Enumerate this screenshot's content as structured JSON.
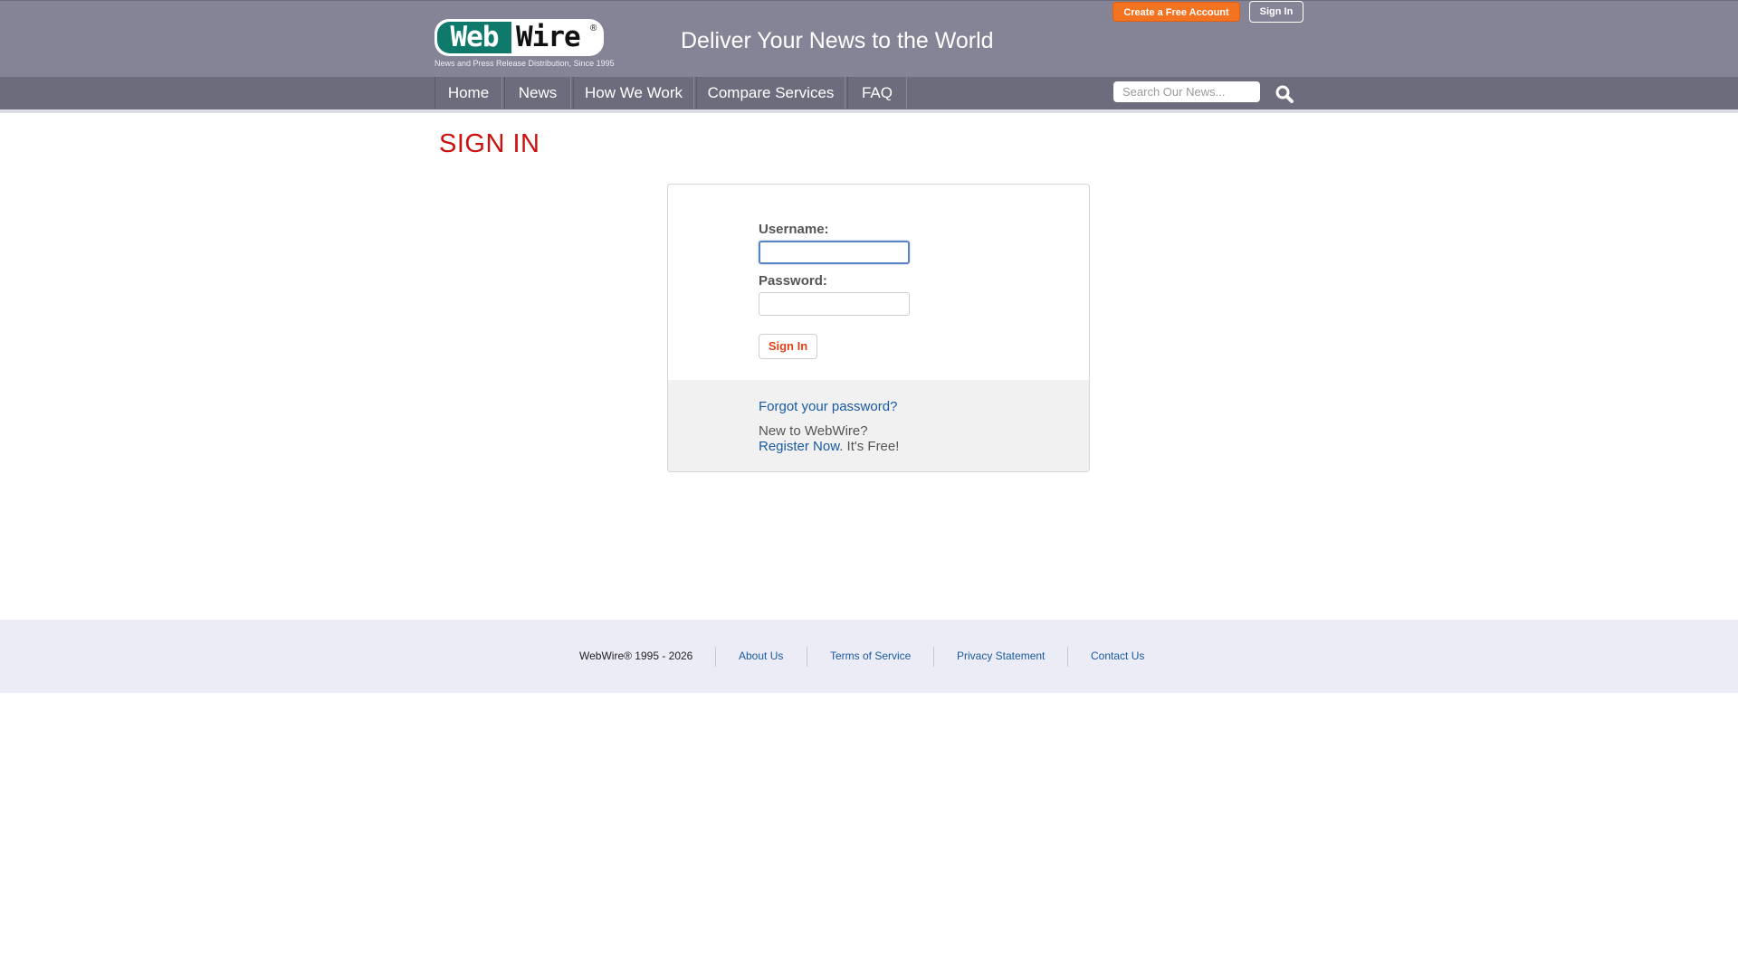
{
  "header": {
    "logo": {
      "web": "Web",
      "wire": "Wire",
      "reg": "®"
    },
    "tagline": "News and Press Release Distribution, Since 1995",
    "slogan": "Deliver Your News to the World",
    "create_account_label": "Create a Free Account",
    "sign_in_label": "Sign In"
  },
  "nav": {
    "items": [
      "Home",
      "News",
      "How We Work",
      "Compare Services",
      "FAQ"
    ],
    "search_placeholder": "Search Our News..."
  },
  "page": {
    "title": "SIGN IN"
  },
  "login": {
    "username_label": "Username:",
    "username_value": "",
    "password_label": "Password:",
    "password_value": "",
    "submit_label": "Sign In",
    "forgot_link": "Forgot your password?",
    "new_to": "New to WebWire?",
    "register_link": "Register Now",
    "register_suffix": ". It's Free!"
  },
  "footer": {
    "copyright": "WebWire® 1995 - 2026",
    "links": [
      "About Us",
      "Terms of Service",
      "Privacy Statement",
      "Contact Us"
    ]
  },
  "colors": {
    "header_bg": "#858496",
    "nav_bg": "#6d6c7d",
    "accent_orange": "#f37320",
    "title_red": "#cc1111",
    "link_blue": "#1a5aa0",
    "logo_green": "#0f7a6b",
    "footer_bg": "#ececf7"
  },
  "icons": {
    "search": "magnifier-icon"
  }
}
